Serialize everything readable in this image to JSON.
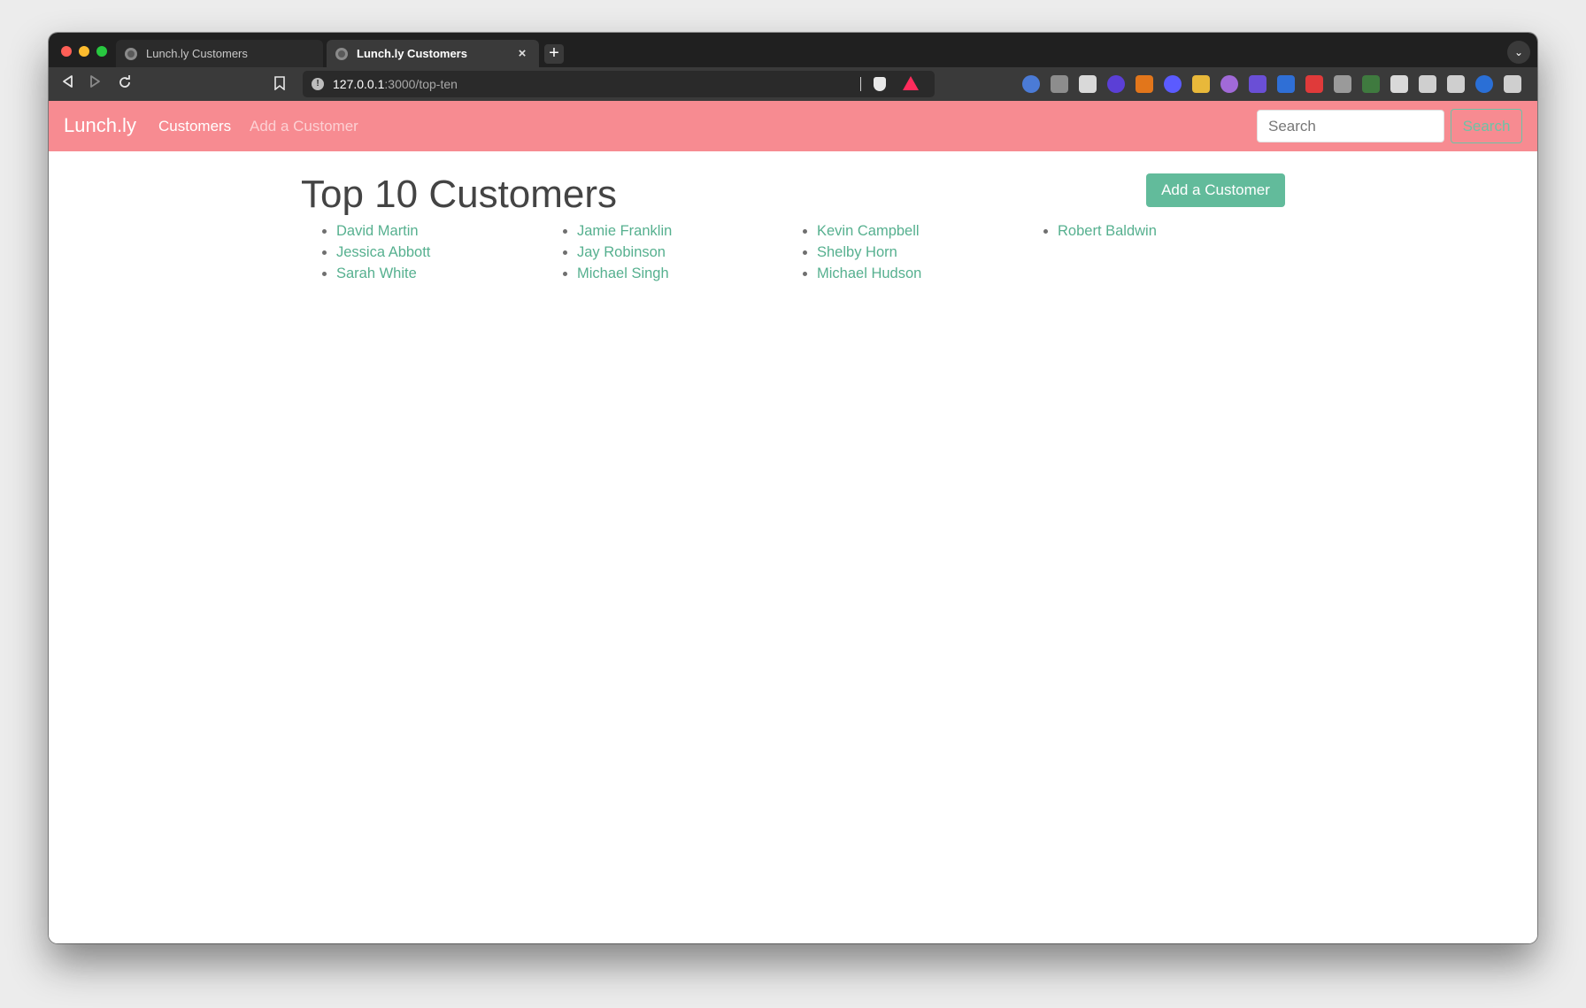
{
  "browser": {
    "tabs": [
      {
        "title": "Lunch.ly Customers",
        "active": false
      },
      {
        "title": "Lunch.ly Customers",
        "active": true
      }
    ],
    "new_tab_label": "+",
    "close_label": "×",
    "url_host": "127.0.0.1",
    "url_path": ":3000/top-ten",
    "icons": {
      "back": "back-arrow-icon",
      "forward": "forward-arrow-icon",
      "reload": "reload-icon",
      "bookmark": "bookmark-icon",
      "site_info": "info-icon",
      "shields": "brave-shield-icon",
      "rewards": "brave-rewards-icon",
      "tab_list": "chevron-down-icon"
    },
    "extension_colors": [
      "#4b7bd6",
      "#c9c9c9",
      "#ffffff",
      "#5b3fd6",
      "#e2761b",
      "#5b5bff",
      "#e8b83a",
      "#a16ad8",
      "#6a4fd6",
      "#2f6fd6",
      "#e03a3a",
      "#9a9a9a",
      "#3f7a3f",
      "#ffffff",
      "#ffffff",
      "#ffffff",
      "#2a6fd6",
      "#ffffff"
    ]
  },
  "navbar": {
    "brand": "Lunch.ly",
    "links": {
      "customers": "Customers",
      "add_customer": "Add a Customer"
    },
    "search_placeholder": "Search",
    "search_button": "Search",
    "background_color": "#f78b91"
  },
  "main": {
    "title": "Top 10 Customers",
    "add_button": "Add a Customer",
    "accent_color": "#62bb9b",
    "columns": [
      [
        "David Martin",
        "Jessica Abbott",
        "Sarah White"
      ],
      [
        "Jamie Franklin",
        "Jay Robinson",
        "Michael Singh"
      ],
      [
        "Kevin Campbell",
        "Shelby Horn",
        "Michael Hudson"
      ],
      [
        "Robert Baldwin"
      ]
    ]
  }
}
